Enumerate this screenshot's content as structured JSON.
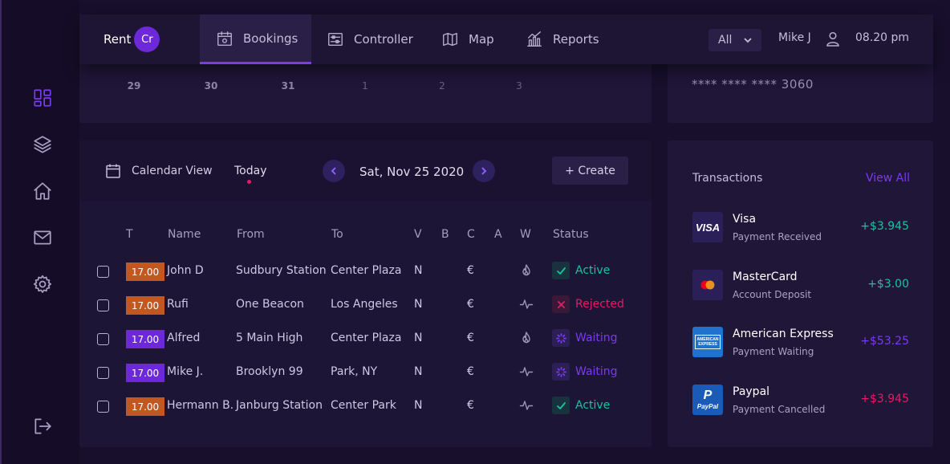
{
  "colors": {
    "accent": "#7c3aed",
    "active_status": "#17c5a0",
    "rejected_status": "#e11d64",
    "waiting_status": "#7c3aed",
    "badge_orange": "#c2581f",
    "badge_purple": "#6d28d9"
  },
  "sidebar": {
    "items": [
      {
        "icon": "dashboard-icon",
        "active": true
      },
      {
        "icon": "layers-icon",
        "active": false
      },
      {
        "icon": "home-icon",
        "active": false
      },
      {
        "icon": "mail-icon",
        "active": false
      },
      {
        "icon": "gear-icon",
        "active": false
      },
      {
        "icon": "logout-icon",
        "active": false
      }
    ]
  },
  "topnav": {
    "brand_text": "Rent",
    "brand_badge": "Cr",
    "tabs": [
      {
        "label": "Bookings",
        "icon": "calendar-icon",
        "active": true
      },
      {
        "label": "Controller",
        "icon": "sliders-icon",
        "active": false
      },
      {
        "label": "Map",
        "icon": "map-icon",
        "active": false
      },
      {
        "label": "Reports",
        "icon": "bar-chart-icon",
        "active": false
      }
    ],
    "filter": "All",
    "user": "Mike J",
    "time": "08.20 pm"
  },
  "date_strip": {
    "days": [
      "29",
      "30",
      "31",
      "1",
      "2",
      "3"
    ]
  },
  "card_strip": {
    "number": "**** **** **** 3060"
  },
  "bookings": {
    "calendar_view": "Calendar View",
    "today": "Today",
    "date": "Sat, Nov 25 2020",
    "create": "+ Create",
    "columns": [
      "T",
      "Name",
      "From",
      "To",
      "V",
      "B",
      "C",
      "A",
      "W",
      "Status"
    ],
    "rows": [
      {
        "time": "17.00",
        "badge": "orange",
        "name": "John D",
        "from": "Sudbury Station",
        "to": "Center Plaza",
        "v": "N",
        "c": "€",
        "w": "flame-icon",
        "status": "Active"
      },
      {
        "time": "17.00",
        "badge": "orange",
        "name": "Rufi",
        "from": "One Beacon",
        "to": "Los Angeles",
        "v": "N",
        "c": "€",
        "w": "pulse-icon",
        "status": "Rejected"
      },
      {
        "time": "17.00",
        "badge": "purple",
        "name": "Alfred",
        "from": "5 Main High",
        "to": "Center Plaza",
        "v": "N",
        "c": "€",
        "w": "flame-icon",
        "status": "Waiting"
      },
      {
        "time": "17.00",
        "badge": "purple",
        "name": "Mike J.",
        "from": "Brooklyn 99",
        "to": "Park, NY",
        "v": "N",
        "c": "€",
        "w": "pulse-icon",
        "status": "Waiting"
      },
      {
        "time": "17.00",
        "badge": "orange",
        "name": "Hermann B.",
        "from": "Janburg Station",
        "to": "Center Park",
        "v": "N",
        "c": "€",
        "w": "pulse-icon",
        "status": "Active"
      }
    ]
  },
  "transactions": {
    "title": "Transactions",
    "view_all": "View All",
    "items": [
      {
        "name": "Visa",
        "sub": "Payment Received",
        "amount": "+$3.945",
        "logo": "visa-logo",
        "logo_text": "VISA",
        "tone": "active"
      },
      {
        "name": "MasterCard",
        "sub": "Account Deposit",
        "amount": "+$3.00",
        "logo": "mastercard-logo",
        "tone": "active"
      },
      {
        "name": "American Express",
        "sub": "Payment Waiting",
        "amount": "+$53.25",
        "logo": "amex-logo",
        "logo_text": "AMERICAN EXPRESS",
        "tone": "waiting"
      },
      {
        "name": "Paypal",
        "sub": "Payment Cancelled",
        "amount": "+$3.945",
        "logo": "paypal-logo",
        "logo_text": "PayPal",
        "tone": "rejected"
      }
    ]
  }
}
